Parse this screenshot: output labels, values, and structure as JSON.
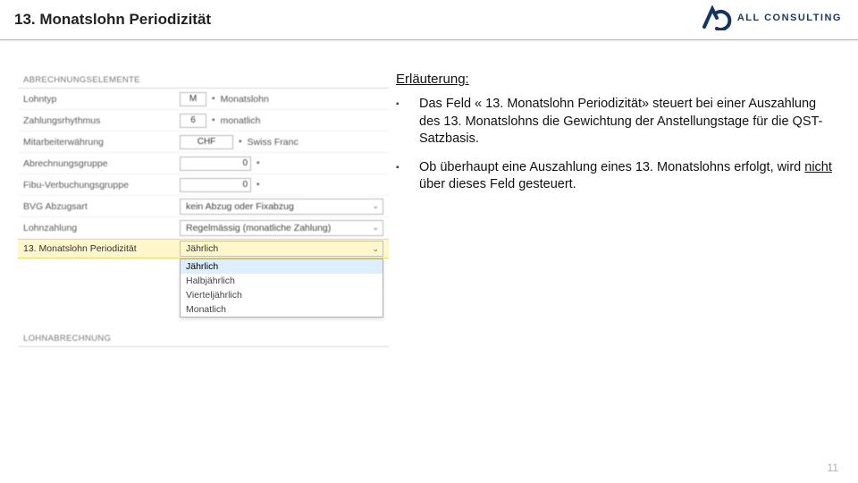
{
  "title": "13. Monatslohn Periodizität",
  "brand": "ALL CONSULTING",
  "form": {
    "section1": "ABRECHNUNGSELEMENTE",
    "section2": "LOHNABRECHNUNG",
    "rows": {
      "lohntyp": {
        "label": "Lohntyp",
        "code": "M",
        "desc": "Monatslohn"
      },
      "zahlungsrhythmus": {
        "label": "Zahlungsrhythmus",
        "code": "6",
        "desc": "monatlich"
      },
      "waehrung": {
        "label": "Mitarbeiterwährung",
        "code": "CHF",
        "desc": "Swiss Franc"
      },
      "abrechnungsgruppe": {
        "label": "Abrechnungsgruppe",
        "value": "0"
      },
      "fibu": {
        "label": "Fibu-Verbuchungsgruppe",
        "value": "0"
      },
      "bvg": {
        "label": "BVG Abzugsart",
        "value": "kein Abzug oder Fixabzug"
      },
      "lohnzahlung": {
        "label": "Lohnzahlung",
        "value": "Regelmässig (monatliche Zahlung)"
      },
      "period": {
        "label": "13. Monatslohn Periodizität",
        "value": "Jährlich"
      }
    },
    "options": [
      "Jährlich",
      "Halbjährlich",
      "Vierteljährlich",
      "Monatlich"
    ]
  },
  "explanation": {
    "heading": "Erläuterung:",
    "items": [
      "Das Feld « 13. Monatslohn Periodizität» steuert bei einer Auszahlung des 13. Monatslohns die Gewichtung der Anstellungstage für die QST-Satzbasis.",
      "Ob überhaupt eine Auszahlung eines 13. Monatslohns erfolgt, wird <u>nicht</u> über dieses Feld gesteuert."
    ]
  },
  "page": "11"
}
